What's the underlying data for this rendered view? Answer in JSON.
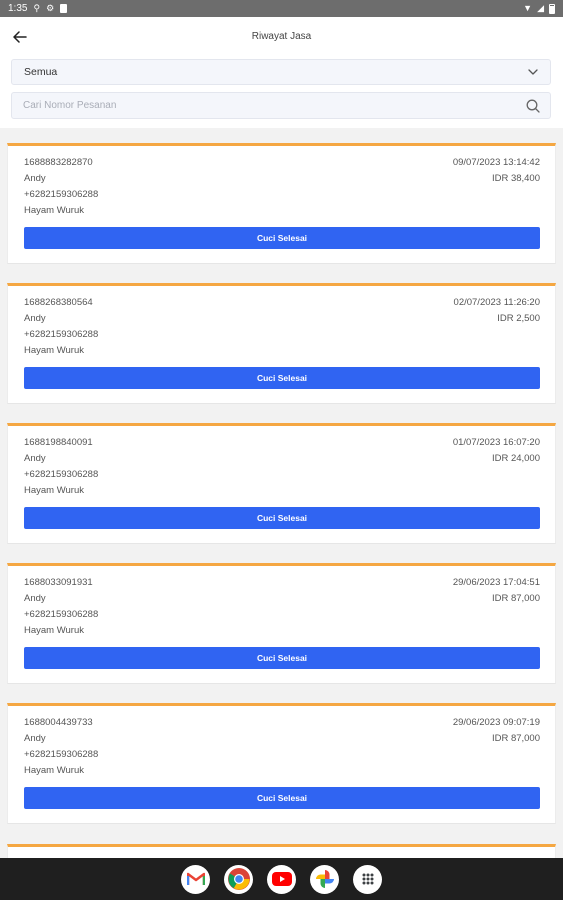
{
  "status_bar": {
    "time": "1:35"
  },
  "header": {
    "title": "Riwayat Jasa"
  },
  "filter": {
    "selected": "Semua"
  },
  "search": {
    "placeholder": "Cari Nomor Pesanan",
    "value": ""
  },
  "orders": [
    {
      "id": "1688883282870",
      "datetime": "09/07/2023 13:14:42",
      "name": "Andy",
      "price": "IDR 38,400",
      "phone": "+6282159306288",
      "address": "Hayam Wuruk",
      "action_label": "Cuci Selesai"
    },
    {
      "id": "1688268380564",
      "datetime": "02/07/2023 11:26:20",
      "name": "Andy",
      "price": "IDR 2,500",
      "phone": "+6282159306288",
      "address": "Hayam Wuruk",
      "action_label": "Cuci Selesai"
    },
    {
      "id": "1688198840091",
      "datetime": "01/07/2023 16:07:20",
      "name": "Andy",
      "price": "IDR 24,000",
      "phone": "+6282159306288",
      "address": "Hayam Wuruk",
      "action_label": "Cuci Selesai"
    },
    {
      "id": "1688033091931",
      "datetime": "29/06/2023 17:04:51",
      "name": "Andy",
      "price": "IDR 87,000",
      "phone": "+6282159306288",
      "address": "Hayam Wuruk",
      "action_label": "Cuci Selesai"
    },
    {
      "id": "1688004439733",
      "datetime": "29/06/2023 09:07:19",
      "name": "Andy",
      "price": "IDR 87,000",
      "phone": "+6282159306288",
      "address": "Hayam Wuruk",
      "action_label": "Cuci Selesai"
    }
  ],
  "colors": {
    "accent": "#3064f2",
    "card_border": "#f5a742"
  },
  "dock": [
    "gmail-icon",
    "chrome-icon",
    "youtube-icon",
    "photos-icon",
    "app-drawer-icon"
  ]
}
